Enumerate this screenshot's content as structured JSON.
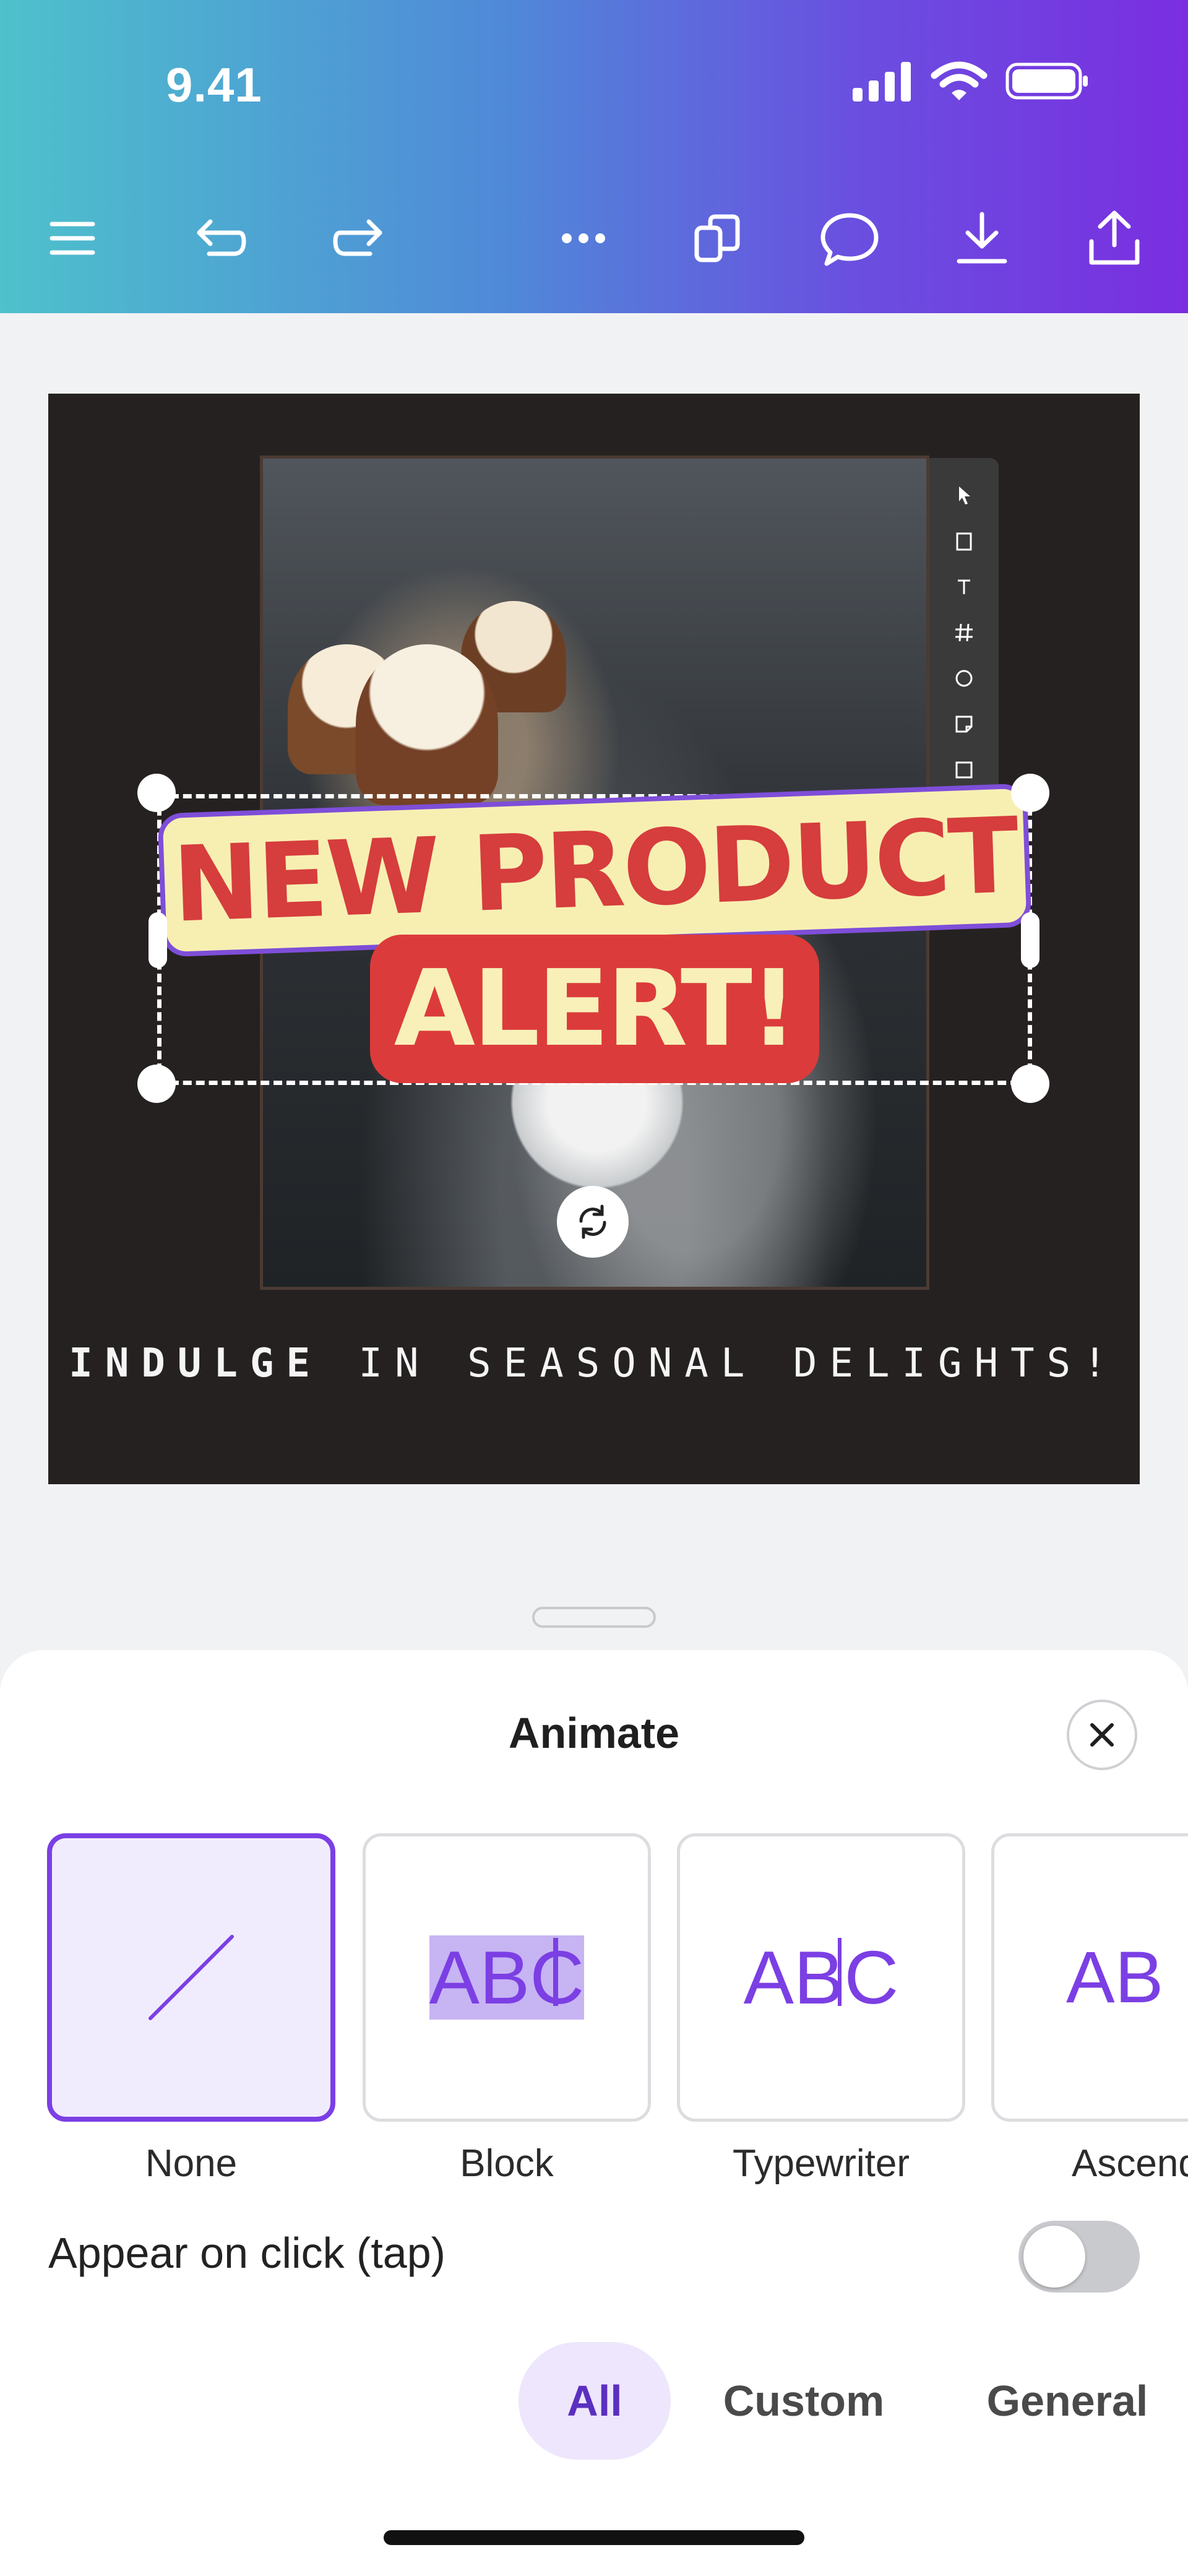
{
  "status_bar": {
    "time": "9.41",
    "icons": [
      "signal-icon",
      "wifi-icon",
      "battery-icon"
    ]
  },
  "toolbar": {
    "items": [
      "menu-icon",
      "undo-icon",
      "redo-icon",
      "more-icon",
      "duplicate-icon",
      "comment-icon",
      "download-icon",
      "share-icon"
    ]
  },
  "design": {
    "headline_line1": "NEW PRODUCT",
    "headline_line2": "ALERT!",
    "tagline_bold": "INDULGE",
    "tagline_rest": " IN SEASONAL DELIGHTS!",
    "side_tools": [
      "cursor-icon",
      "page-icon",
      "text-icon",
      "grid-icon",
      "circle-icon",
      "sticky-icon",
      "upload-icon"
    ]
  },
  "animate_panel": {
    "title": "Animate",
    "options": [
      {
        "label": "None",
        "preview": "",
        "selected": true
      },
      {
        "label": "Block",
        "preview": "ABC",
        "selected": false
      },
      {
        "label": "Typewriter",
        "preview": "ABC",
        "selected": false
      },
      {
        "label": "Ascend",
        "preview": "AB",
        "selected": false
      }
    ],
    "toggle_label": "Appear on click (tap)",
    "toggle_on": false,
    "tabs": [
      "All",
      "Custom",
      "General"
    ],
    "active_tab": "All"
  },
  "colors": {
    "accent": "#7b3fe4",
    "banner_red": "#dc3b3b",
    "banner_cream": "#f7efb2",
    "artboard": "#252120"
  }
}
